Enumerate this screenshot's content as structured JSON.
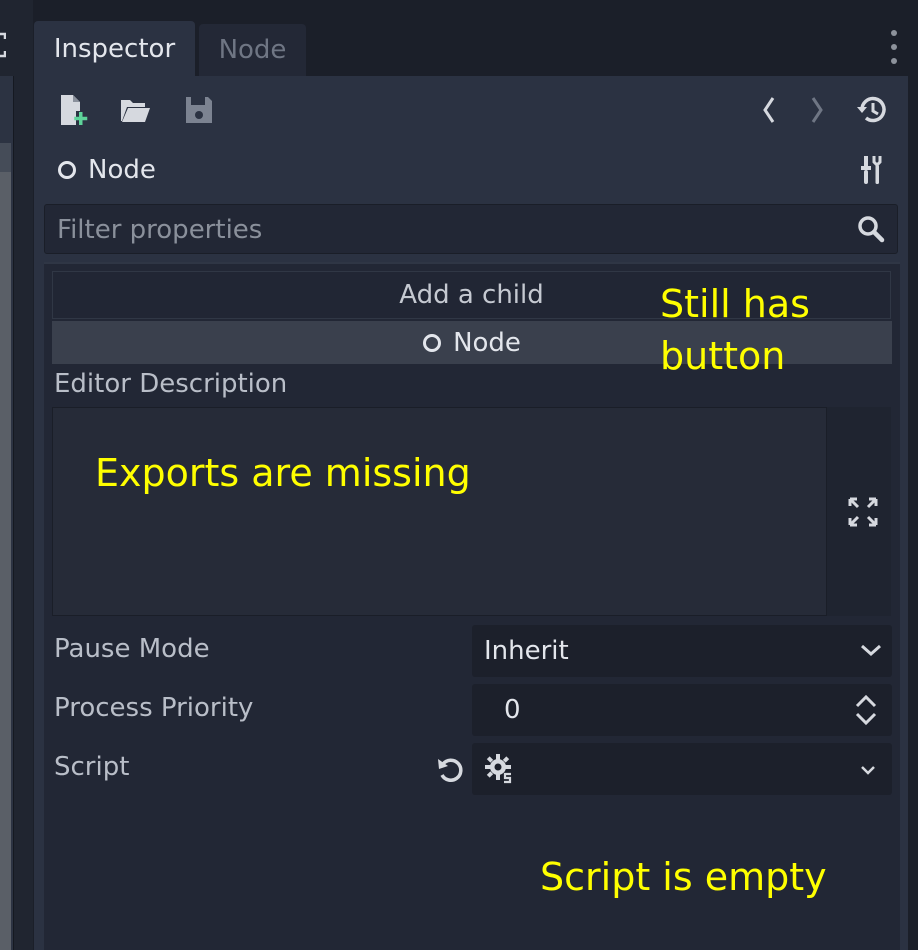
{
  "tabs": [
    {
      "label": "Inspector",
      "active": true
    },
    {
      "label": "Node",
      "active": false
    }
  ],
  "toolbar": {
    "icons": [
      "new-resource-icon",
      "open-folder-icon",
      "save-icon",
      "history-back-icon",
      "history-forward-icon",
      "object-history-icon"
    ]
  },
  "header": {
    "node_name": "Node",
    "node_icon": "node-ring-icon",
    "tools_icon": "tools-icon"
  },
  "filter": {
    "placeholder": "Filter properties"
  },
  "add_child": {
    "header": "Add a child",
    "button_label": "Node"
  },
  "properties": {
    "editor_description": {
      "label": "Editor Description",
      "value": ""
    },
    "pause_mode": {
      "label": "Pause Mode",
      "value": "Inherit"
    },
    "process_priority": {
      "label": "Process Priority",
      "value": "0"
    },
    "script": {
      "label": "Script",
      "value": ""
    }
  },
  "annotations": {
    "still_has_button_line1": "Still has",
    "still_has_button_line2": "button",
    "exports_missing": "Exports are missing",
    "script_empty": "Script is empty"
  },
  "colors": {
    "annotation": "#ffff00",
    "panel": "#2b3242",
    "add_icon_accent": "#5ed39a"
  }
}
